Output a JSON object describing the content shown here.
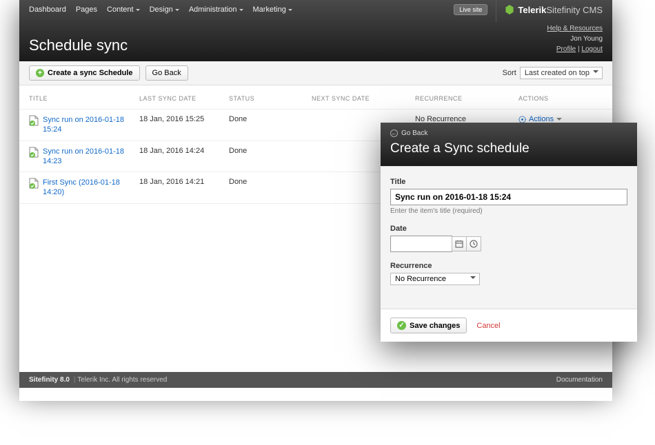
{
  "nav": {
    "items": [
      "Dashboard",
      "Pages",
      "Content",
      "Design",
      "Administration",
      "Marketing"
    ],
    "dropdown_flags": [
      false,
      false,
      true,
      true,
      true,
      true
    ],
    "live_site": "Live site",
    "brand_bold": "Telerik",
    "brand_light": "Sitefinity CMS",
    "help": "Help & Resources",
    "user": "Jon Young",
    "profile": "Profile",
    "logout": "Logout"
  },
  "page_title": "Schedule sync",
  "toolbar": {
    "create": "Create a sync Schedule",
    "go_back": "Go Back",
    "sort_label": "Sort",
    "sort_value": "Last created on top"
  },
  "table": {
    "headers": {
      "title": "TITLE",
      "last": "LAST SYNC DATE",
      "status": "STATUS",
      "next": "NEXT SYNC DATE",
      "recurrence": "RECURRENCE",
      "actions": "ACTIONS"
    },
    "rows": [
      {
        "title": "Sync run on 2016-01-18 15:24",
        "last": "18 Jan, 2016 15:25",
        "status": "Done",
        "next": "",
        "recurrence": "No Recurrence",
        "actions": "Actions"
      },
      {
        "title": "Sync run on 2016-01-18 14:23",
        "last": "18 Jan, 2016 14:24",
        "status": "Done",
        "next": "",
        "recurrence": "",
        "actions": ""
      },
      {
        "title": "First Sync (2016-01-18 14:20)",
        "last": "18 Jan, 2016 14:21",
        "status": "Done",
        "next": "",
        "recurrence": "",
        "actions": ""
      }
    ]
  },
  "footer": {
    "version": "Sitefinity 8.0",
    "copyright": "Telerik Inc. All rights reserved",
    "doc": "Documentation"
  },
  "dialog": {
    "go_back": "Go Back",
    "title": "Create a Sync schedule",
    "fields": {
      "title_label": "Title",
      "title_value": "Sync run on 2016-01-18 15:24",
      "title_help": "Enter the item's title (required)",
      "date_label": "Date",
      "recurrence_label": "Recurrence",
      "recurrence_value": "No Recurrence"
    },
    "save": "Save changes",
    "cancel": "Cancel"
  }
}
